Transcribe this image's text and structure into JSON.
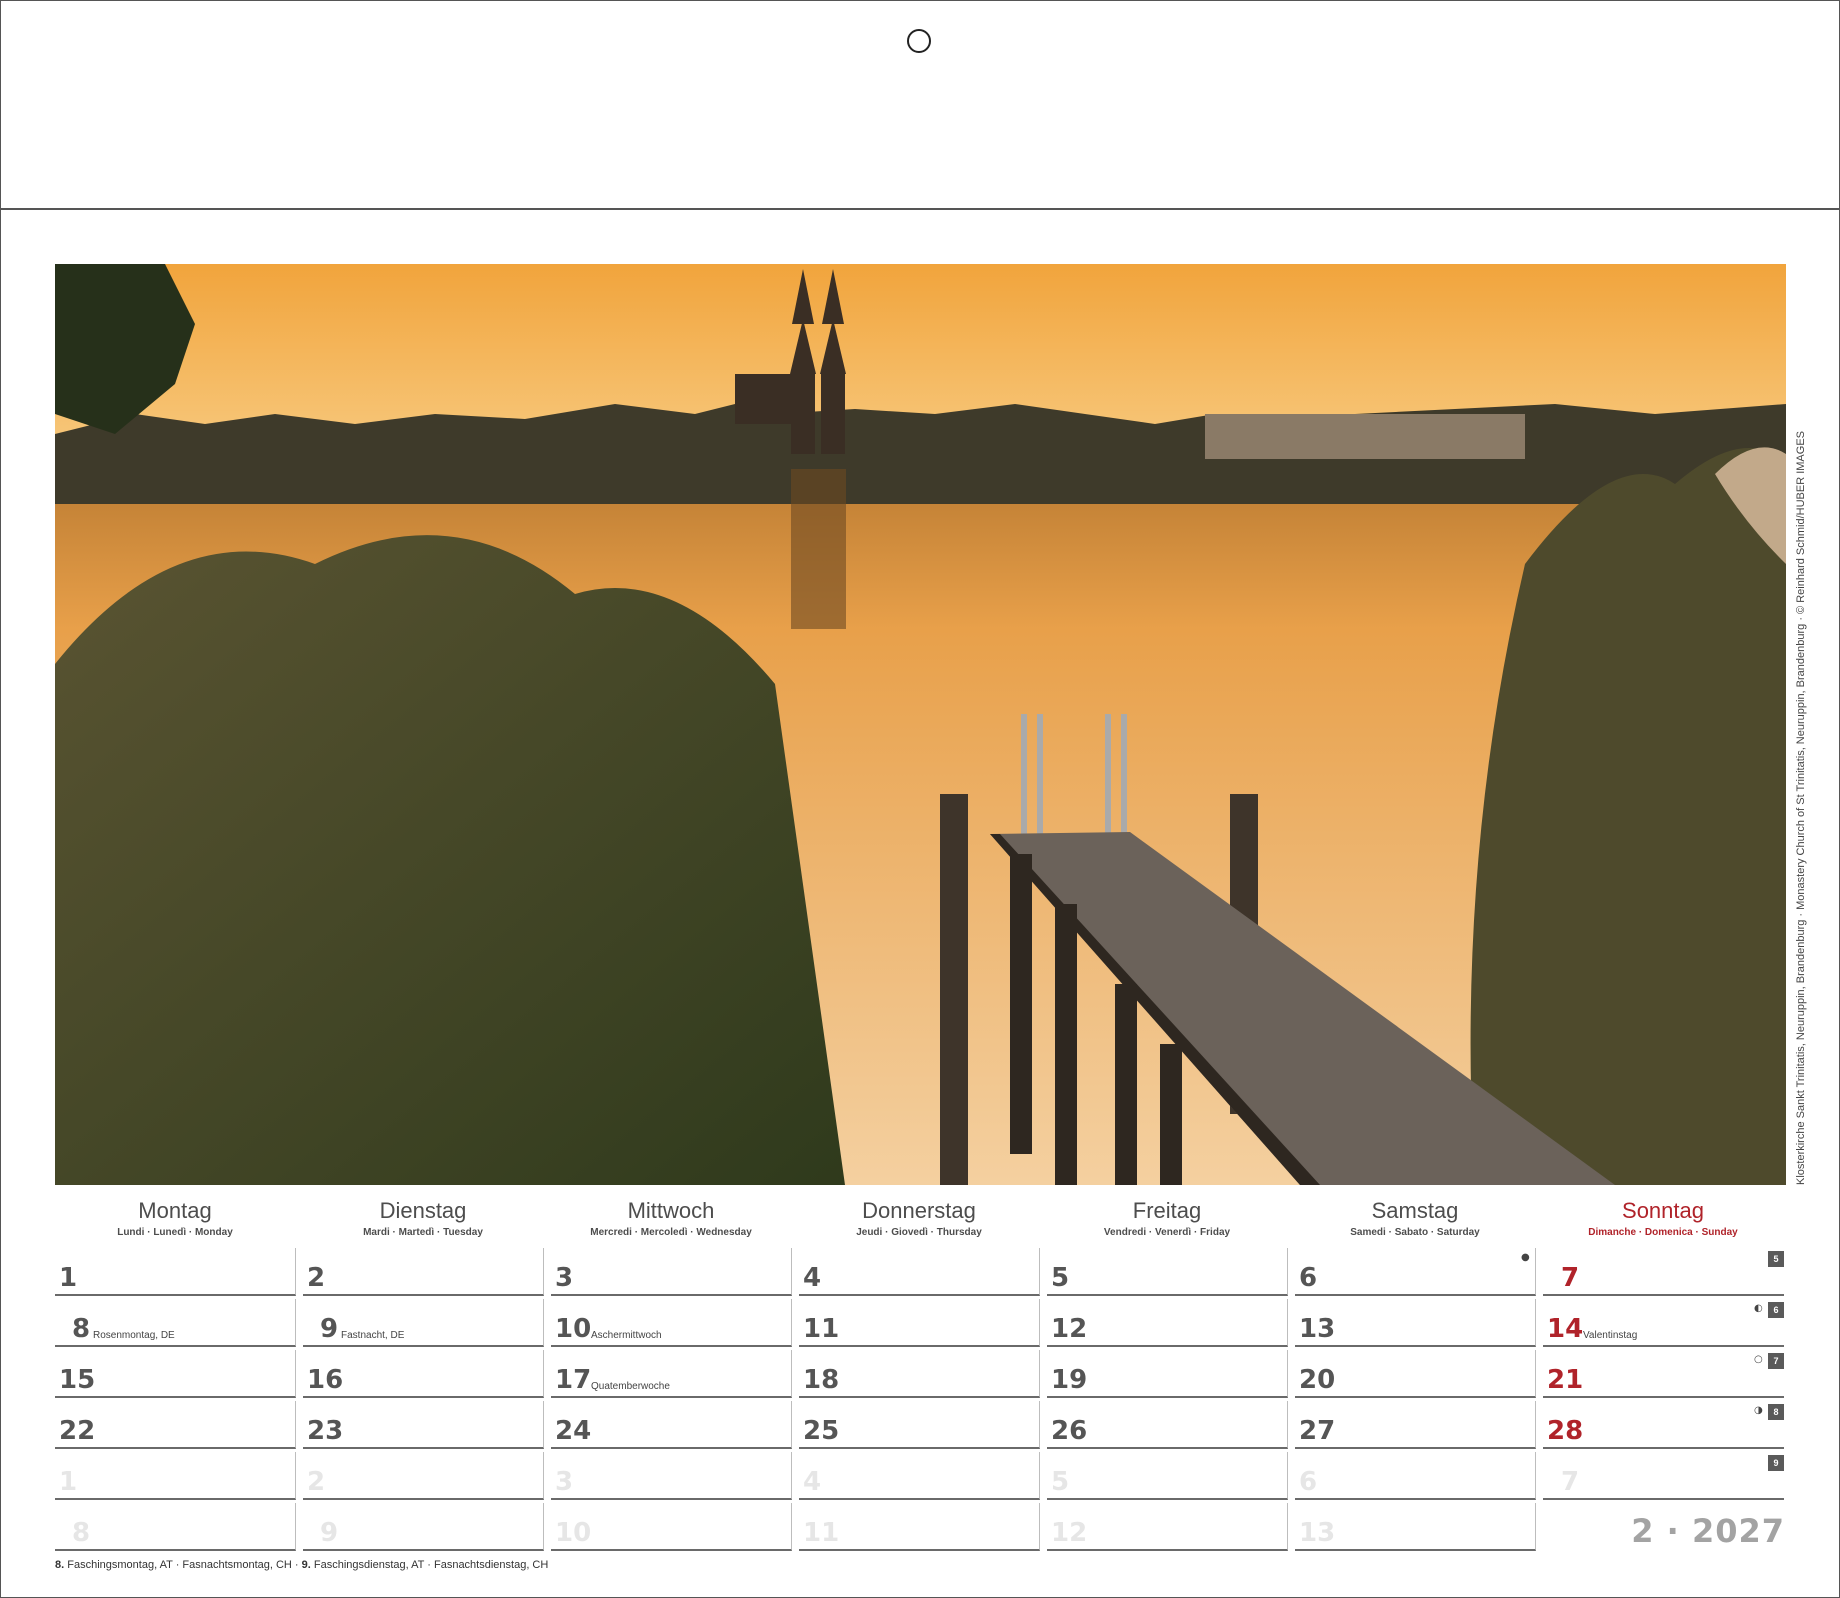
{
  "photo": {
    "alt": "Klosterkirche Sankt Trinitatis, Neuruppin, Brandenburg",
    "credit": "Klosterkirche Sankt Trinitatis, Neuruppin, Brandenburg · Monastery Church of St Trinitatis, Neuruppin, Brandenburg · © Reinhard Schmid/HUBER IMAGES"
  },
  "weekdays": [
    {
      "name": "Montag",
      "sub": "Lundi · Lunedì · Monday"
    },
    {
      "name": "Dienstag",
      "sub": "Mardi · Martedì · Tuesday"
    },
    {
      "name": "Mittwoch",
      "sub": "Mercredi · Mercoledì · Wednesday"
    },
    {
      "name": "Donnerstag",
      "sub": "Jeudi · Giovedì · Thursday"
    },
    {
      "name": "Freitag",
      "sub": "Vendredi · Venerdì · Friday"
    },
    {
      "name": "Samstag",
      "sub": "Samedi · Sabato · Saturday"
    },
    {
      "name": "Sonntag",
      "sub": "Dimanche · Domenica · Sunday"
    }
  ],
  "weeks": [
    {
      "week": "5",
      "days": [
        "1",
        "2",
        "3",
        "4",
        "5",
        "6",
        "7"
      ]
    },
    {
      "week": "6",
      "days": [
        "8",
        "9",
        "10",
        "11",
        "12",
        "13",
        "14"
      ]
    },
    {
      "week": "7",
      "days": [
        "15",
        "16",
        "17",
        "18",
        "19",
        "20",
        "21"
      ]
    },
    {
      "week": "8",
      "days": [
        "22",
        "23",
        "24",
        "25",
        "26",
        "27",
        "28"
      ]
    },
    {
      "week": "9",
      "days": [
        "1",
        "2",
        "3",
        "4",
        "5",
        "6",
        "7"
      ]
    },
    {
      "week": "",
      "days": [
        "8",
        "9",
        "10",
        "11",
        "12",
        "13",
        ""
      ]
    }
  ],
  "holidays": {
    "rosenmontag": "Rosenmontag, DE",
    "fastnacht": "Fastnacht, DE",
    "aschermittwoch": "Aschermittwoch",
    "valentinstag": "Valentinstag",
    "quatemberwoche": "Quatemberwoche"
  },
  "moon_phases": [
    {
      "day": "6",
      "symbol": "●"
    },
    {
      "day": "14",
      "symbol": "◐"
    },
    {
      "day": "21",
      "symbol": "○"
    },
    {
      "day": "28",
      "symbol": "◑"
    }
  ],
  "month_year": "2 · 2027",
  "footnote": {
    "d1": "8.",
    "t1": "Faschingsmontag, AT",
    "t2": "Fasnachtsmontag, CH",
    "d2": "9.",
    "t3": "Faschingsdienstag, AT",
    "t4": "Fasnachtsdienstag, CH",
    "sep": "·"
  },
  "colors": {
    "sunday": "#b0232a",
    "day_number": "#555555",
    "faded": "#e6e6e6",
    "month_year": "#a3a3a3"
  }
}
